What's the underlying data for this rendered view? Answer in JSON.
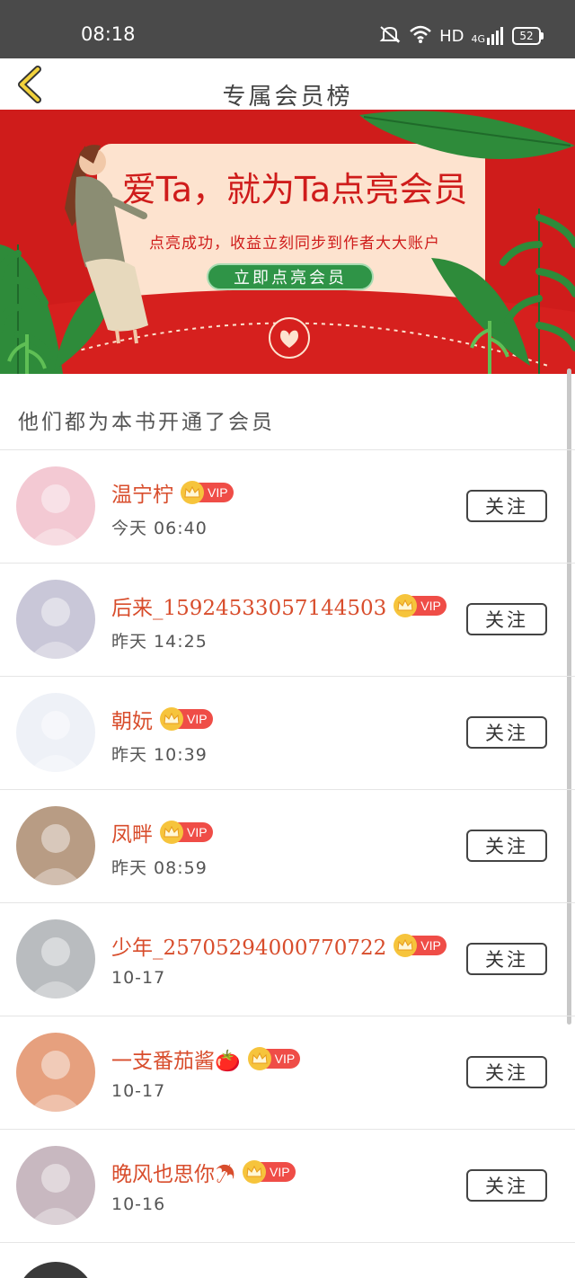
{
  "status_bar": {
    "time": "08:18",
    "network": "HD",
    "signal_label": "4G",
    "battery": "52"
  },
  "header": {
    "title": "专属会员榜"
  },
  "banner": {
    "headline": "爱Ta，就为Ta点亮会员",
    "subtitle": "点亮成功，收益立刻同步到作者大大账户",
    "button": "立即点亮会员"
  },
  "section_title": "他们都为本书开通了会员",
  "vip_label": "VIP",
  "follow_label": "关注",
  "members": [
    {
      "name": "温宁柠",
      "time": "今天 06:40",
      "avatar_color": "#f3c9d3"
    },
    {
      "name": "后来_15924533057144503",
      "time": "昨天 14:25",
      "avatar_color": "#c9c7d8"
    },
    {
      "name": "朝妧",
      "time": "昨天 10:39",
      "avatar_color": "#eef1f7"
    },
    {
      "name": "凤畔",
      "time": "昨天 08:59",
      "avatar_color": "#b89c84"
    },
    {
      "name": "少年_25705294000770722",
      "time": "10-17",
      "avatar_color": "#b9bcbf"
    },
    {
      "name": "一支番茄酱🍅",
      "time": "10-17",
      "avatar_color": "#e6a07e"
    },
    {
      "name": "晚风也思你☂",
      "time": "10-16",
      "avatar_color": "#c8b8c0"
    }
  ]
}
